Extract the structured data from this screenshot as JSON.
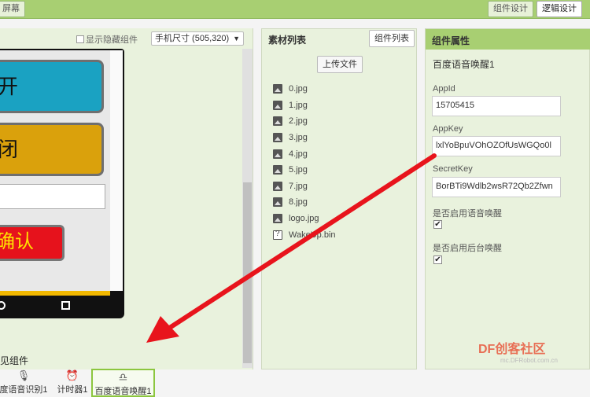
{
  "topbar": {
    "left_label": "屏幕",
    "design_label": "组件设计",
    "logic_label": "逻辑设计"
  },
  "viewer": {
    "show_hidden_label": "显示隐藏组件",
    "size_select": "手机尺寸 (505,320)",
    "buttons": {
      "open": "开",
      "close": "闭",
      "confirm": "确认"
    },
    "nonvisible_title": "见组件",
    "nonvisible_items": [
      {
        "label": "度语音识别1",
        "icon": "microphone-icon"
      },
      {
        "label": "计时器1",
        "icon": "timer-icon"
      },
      {
        "label": "百度语音唤醒1",
        "icon": "wake-icon"
      }
    ]
  },
  "materials": {
    "title": "素材列表",
    "tab": "组件列表",
    "upload": "上传文件",
    "files": [
      "0.jpg",
      "1.jpg",
      "2.jpg",
      "3.jpg",
      "4.jpg",
      "5.jpg",
      "7.jpg",
      "8.jpg",
      "logo.jpg",
      "WakeUp.bin"
    ]
  },
  "props": {
    "title": "组件属性",
    "component": "百度语音唤醒1",
    "appid_label": "AppId",
    "appid_value": "15705415",
    "appkey_label": "AppKey",
    "appkey_value": "lxlYoBpuVOhOZOfUsWGQo0l",
    "secret_label": "SecretKey",
    "secret_value": "BorBTi9Wdlb2wsR72Qb2Zfwn",
    "enable_voice_label": "是否启用语音唤醒",
    "enable_bg_label": "是否启用后台唤醒"
  },
  "watermark": {
    "text": "DF创客社区",
    "sub": "mc.DFRobot.com.cn"
  },
  "colors": {
    "accent": "#a8cf72",
    "arrow": "#e8141c"
  }
}
